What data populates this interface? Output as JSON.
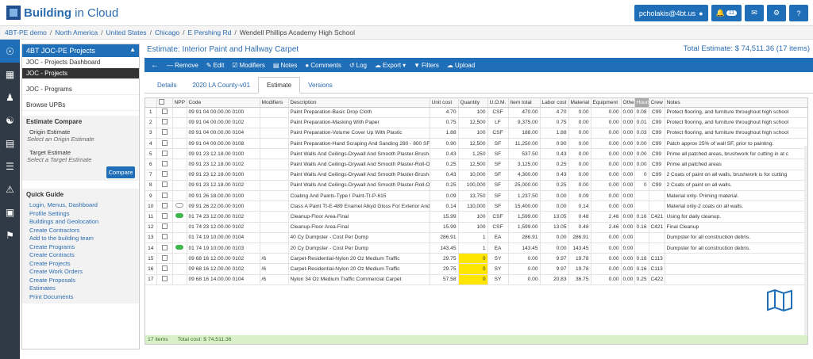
{
  "app": {
    "logo_main": "Building",
    "logo_rest": " in Cloud"
  },
  "header": {
    "user": "pcholakis@4bt.us",
    "notifications": "11"
  },
  "breadcrumb": [
    "4BT-PE demo",
    "North America",
    "United States",
    "Chicago",
    "E Pershing Rd",
    "Wendell Phillips Academy High School"
  ],
  "panel": {
    "title": "4BT JOC-PE Projects",
    "items": [
      "JOC - Projects Dashboard",
      "JOC - Projects",
      "JOC - Programs",
      "Browse UPBs"
    ],
    "compare": {
      "title": "Estimate Compare",
      "origin_label": "Origin Estimate",
      "origin_hint": "Select an Origin Estimate",
      "target_label": "Target Estimate",
      "target_hint": "Select a Target Estimate",
      "button": "Compare"
    },
    "guide_title": "Quick Guide",
    "guide": [
      "Login, Menus, Dashboard",
      "Profile Settings",
      "Buildings and Geolocation",
      "Create Contractors",
      "Add to the building team",
      "Create Programs",
      "Create Contracts",
      "Create Projects",
      "Create Work Orders",
      "Create Proposals",
      "Estimates",
      "Print Documents"
    ]
  },
  "main": {
    "title": "Estimate: Interior Paint and Hallway Carpet",
    "total": "Total Estimate: $ 74,511.36 (17 items)",
    "toolbar": [
      "Remove",
      "Edit",
      "Modifiers",
      "Notes",
      "Comments",
      "Log",
      "Export",
      "Filters",
      "Upload"
    ],
    "tabs": [
      "Details",
      "2020 LA County-v01",
      "Estimate",
      "Versions"
    ]
  },
  "table": {
    "headers": [
      "",
      "NPP",
      "Code",
      "Modifiers",
      "Description",
      "Unit cost",
      "Quantity",
      "U.O.M.",
      "Item total",
      "Labor cost",
      "Material",
      "Equipment",
      "Othe",
      "Hours",
      "Crew",
      "Notes"
    ],
    "rows": [
      [
        "1",
        "",
        "09 91 04 00.00.00 0100",
        "",
        "Paint Preparation-Basic Drop Cloth",
        "4.70",
        "100",
        "CSF",
        "470.00",
        "4.70",
        "0.00",
        "0.00",
        "0.00",
        "0.08",
        "C99",
        "Protect flooring, and furniture throughout high school"
      ],
      [
        "2",
        "",
        "09 91 04 00.00.00 0102",
        "",
        "Paint Preparation-Masking With Paper",
        "0.75",
        "12,500",
        "LF",
        "9,375.00",
        "0.75",
        "0.00",
        "0.00",
        "0.00",
        "0.01",
        "C99",
        "Protect flooring, and furniture throughout high school"
      ],
      [
        "3",
        "",
        "09 91 04 00.00.00 0104",
        "",
        "Paint Preparation-Volume Cover Up With Plastic",
        "1.88",
        "100",
        "CSF",
        "188.00",
        "1.88",
        "0.00",
        "0.00",
        "0.00",
        "0.03",
        "C99",
        "Protect flooring, and furniture throughout high school"
      ],
      [
        "4",
        "",
        "09 91 04 00.00.00 0108",
        "",
        "Paint Preparation-Hand Scraping And Sanding 280 - 800 SF Per D",
        "0.90",
        "12,500",
        "SF",
        "11,250.00",
        "0.90",
        "0.00",
        "0.00",
        "0.00",
        "0.00",
        "C99",
        "Patch approx 25% of wall SF, prior to painting."
      ],
      [
        "5",
        "",
        "09 91 23 12.18.00 0100",
        "",
        "Paint Walls And Ceilings-Drywall And Smooth Plaster-Brush-One C",
        "0.43",
        "1,250",
        "SF",
        "537.50",
        "0.43",
        "0.00",
        "0.00",
        "0.00",
        "0.00",
        "C99",
        "Prime all patched areas, brushwork for cutting in at c"
      ],
      [
        "6",
        "",
        "09 91 23 12.18.00 0102",
        "",
        "Paint Walls And Ceilings-Drywall And Smooth Plaster-Roll-One Co",
        "0.25",
        "12,500",
        "SF",
        "3,125.00",
        "0.25",
        "0.00",
        "0.00",
        "0.00",
        "0.00",
        "C99",
        "Prime all patched areas"
      ],
      [
        "7",
        "",
        "09 91 23 12.18.00 0100",
        "",
        "Paint Walls And Ceilings-Drywall And Smooth Plaster-Brush-One C",
        "0.43",
        "10,000",
        "SF",
        "4,300.00",
        "0.43",
        "0.00",
        "0.00",
        "0.00",
        "0",
        "C99",
        "2 Coats of paint on all walls, brushwork is for cutting"
      ],
      [
        "8",
        "",
        "09 91 23 12.18.00 0102",
        "",
        "Paint Walls And Ceilings-Drywall And Smooth Plaster-Roll-One Co",
        "0.25",
        "100,000",
        "SF",
        "25,000.00",
        "0.25",
        "0.00",
        "0.00",
        "0.00",
        "0",
        "C99",
        "2 Coats of paint on all walls."
      ],
      [
        "9",
        "",
        "09 91 26 18.00.00 0100",
        "",
        "Coating And Paints-Type I Paint-Tt-P-615",
        "0.09",
        "13,750",
        "SF",
        "1,237.50",
        "0.00",
        "0.09",
        "0.00",
        "0.00",
        "",
        "",
        "Material only- Priming material."
      ],
      [
        "10",
        "o",
        "09 91 26 22.00.00 0100",
        "",
        "Class A Paint Tt-E-489 Enamel Alkyd Gloss For Exterior And Inter",
        "0.14",
        "110,000",
        "SF",
        "15,400.00",
        "0.00",
        "0.14",
        "0.00",
        "0.00",
        "",
        "",
        "Material only-2 coats on all walls."
      ],
      [
        "11",
        "g",
        "01 74 23 12.00.00 0102",
        "",
        "Cleanup-Floor Area-Final",
        "15.99",
        "100",
        "CSF",
        "1,599.00",
        "13.05",
        "0.48",
        "2.46",
        "0.00",
        "0.16",
        "C421",
        "Using for daily cleanup."
      ],
      [
        "12",
        "",
        "01 74 23 12.00.00 0102",
        "",
        "Cleanup-Floor Area-Final",
        "15.99",
        "100",
        "CSF",
        "1,599.00",
        "13.05",
        "0.48",
        "2.46",
        "0.00",
        "0.16",
        "C421",
        "Final Cleanup"
      ],
      [
        "13",
        "",
        "01 74 19 10.00.00 0104",
        "",
        "40 Cy Dumpster - Cost Per Dump",
        "286.91",
        "1",
        "EA",
        "286.91",
        "0.00",
        "286.91",
        "0.00",
        "0.00",
        "",
        "",
        "Dumpster for all construction debris."
      ],
      [
        "14",
        "g",
        "01 74 19 10.00.00 0103",
        "",
        "20 Cy Dumpster - Cost Per Dump",
        "143.45",
        "1",
        "EA",
        "143.45",
        "0.00",
        "143.45",
        "0.00",
        "0.00",
        "",
        "",
        "Dumpster for all construction debris."
      ],
      [
        "15",
        "",
        "09 68 16 12.00.00 0102",
        "/6",
        "Carpet-Residential-Nylon 20 Oz Medium Traffic",
        "29.75",
        "0",
        "SY",
        "0.00",
        "9.97",
        "19.78",
        "0.00",
        "0.00",
        "0.16",
        "C113",
        ""
      ],
      [
        "16",
        "",
        "09 68 16 12.00.00 0102",
        "/6",
        "Carpet-Residential-Nylon 20 Oz Medium Traffic",
        "29.75",
        "0",
        "SY",
        "0.00",
        "9.97",
        "19.78",
        "0.00",
        "0.00",
        "0.16",
        "C113",
        ""
      ],
      [
        "17",
        "",
        "09 68 16 14.00.00 0104",
        "/6",
        "Nylon 34 Oz Medium Traffic Commercial Carpet",
        "57.58",
        "0",
        "SY",
        "0.00",
        "20.83",
        "36.75",
        "0.00",
        "0.00",
        "0.25",
        "C422",
        ""
      ]
    ],
    "footer_items": "17 items",
    "footer_total": "Total cost: $ 74,511.36"
  },
  "colors": {
    "accent": "#1f6fb8",
    "highlight": "#ffe600",
    "footer": "#d9f0c8"
  }
}
